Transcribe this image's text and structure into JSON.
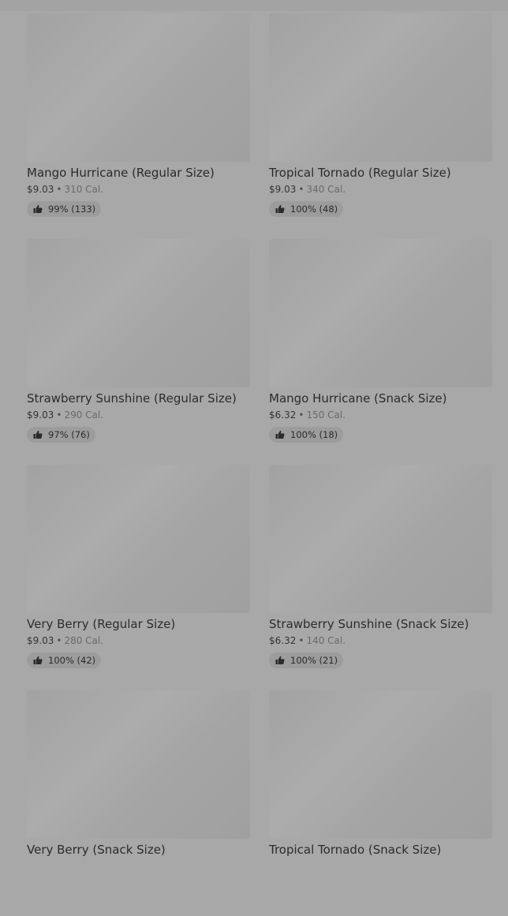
{
  "items": [
    {
      "title": "Mango Hurricane (Regular Size)",
      "price": "$9.03",
      "calories": "310 Cal.",
      "rating": "99% (133)"
    },
    {
      "title": "Tropical Tornado (Regular Size)",
      "price": "$9.03",
      "calories": "340 Cal.",
      "rating": "100% (48)"
    },
    {
      "title": "Strawberry Sunshine (Regular Size)",
      "price": "$9.03",
      "calories": "290 Cal.",
      "rating": "97% (76)"
    },
    {
      "title": "Mango Hurricane (Snack Size)",
      "price": "$6.32",
      "calories": "150 Cal.",
      "rating": "100% (18)"
    },
    {
      "title": "Very Berry (Regular Size)",
      "price": "$9.03",
      "calories": "280 Cal.",
      "rating": "100% (42)"
    },
    {
      "title": "Strawberry Sunshine (Snack Size)",
      "price": "$6.32",
      "calories": "140 Cal.",
      "rating": "100% (21)"
    },
    {
      "title": "Very Berry (Snack Size)"
    },
    {
      "title": "Tropical Tornado (Snack Size)"
    }
  ],
  "separator": "•",
  "icons": {
    "rating": "thumbs-up-icon"
  },
  "colors": {
    "overlay": "#a8a8a8",
    "text": "#2b2b2b",
    "badge": "#9c9c9c"
  }
}
